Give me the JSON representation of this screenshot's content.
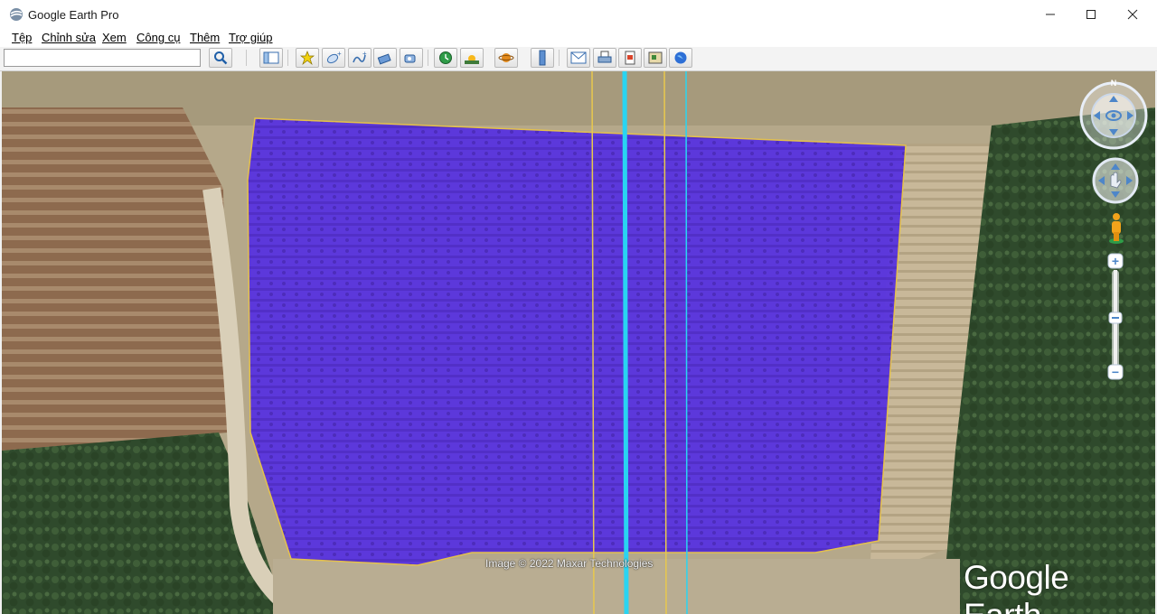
{
  "window": {
    "title": "Google Earth Pro",
    "controls": [
      "minimize-icon",
      "maximize-icon",
      "close-icon"
    ]
  },
  "menu": {
    "items": [
      "Tệp",
      "Chỉnh sửa",
      "Xem",
      "Công cụ",
      "Thêm",
      "Trợ giúp"
    ]
  },
  "toolbar": {
    "search_value": "",
    "buttons": [
      "search-icon",
      "sidebar-icon",
      "placemark-icon",
      "polygon-icon",
      "path-icon",
      "image-overlay-icon",
      "tour-icon",
      "historical-imagery-icon",
      "sunlight-icon",
      "planets-icon",
      "ruler-icon",
      "email-icon",
      "print-icon",
      "save-image-icon",
      "view-in-maps-icon",
      "earth-gallery-icon"
    ]
  },
  "map": {
    "attribution": "Image © 2022 Maxar Technologies",
    "brand": "Google Earth",
    "compass_north": "N",
    "overlay_color": "#5a2fe0",
    "line_color": "#2fd3f0"
  },
  "nav_controls": {
    "zoom_in": "+",
    "zoom_out": "−",
    "icons": [
      "look-joystick-icon",
      "move-joystick-icon",
      "street-view-pegman-icon",
      "zoom-slider-icon"
    ]
  }
}
